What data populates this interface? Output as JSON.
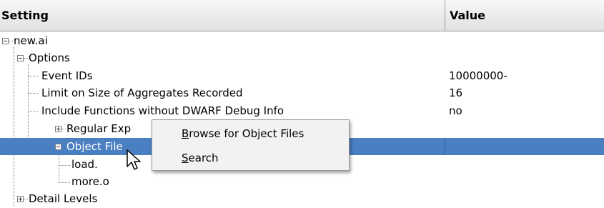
{
  "header": {
    "setting_label": "Setting",
    "value_label": "Value"
  },
  "tree": {
    "root": "new.ai",
    "options": "Options",
    "event_ids": {
      "label": "Event IDs",
      "value": "10000000-"
    },
    "limit": {
      "label": "Limit on Size of Aggregates Recorded",
      "value": "16"
    },
    "include_funcs": {
      "label": "Include Functions without DWARF Debug Info",
      "value": "no"
    },
    "regex": "Regular Exp",
    "object_files": "Object File",
    "load": "load.",
    "more": "more.o",
    "detail_levels": "Detail Levels"
  },
  "context_menu": {
    "browse": {
      "mnemonic": "B",
      "rest": "rowse for Object Files"
    },
    "search": {
      "mnemonic": "S",
      "rest": "earch"
    }
  },
  "colors": {
    "selection": "#4a7fc1",
    "header_bg": "#e8e8e8",
    "menu_bg": "#f2f2f2"
  }
}
